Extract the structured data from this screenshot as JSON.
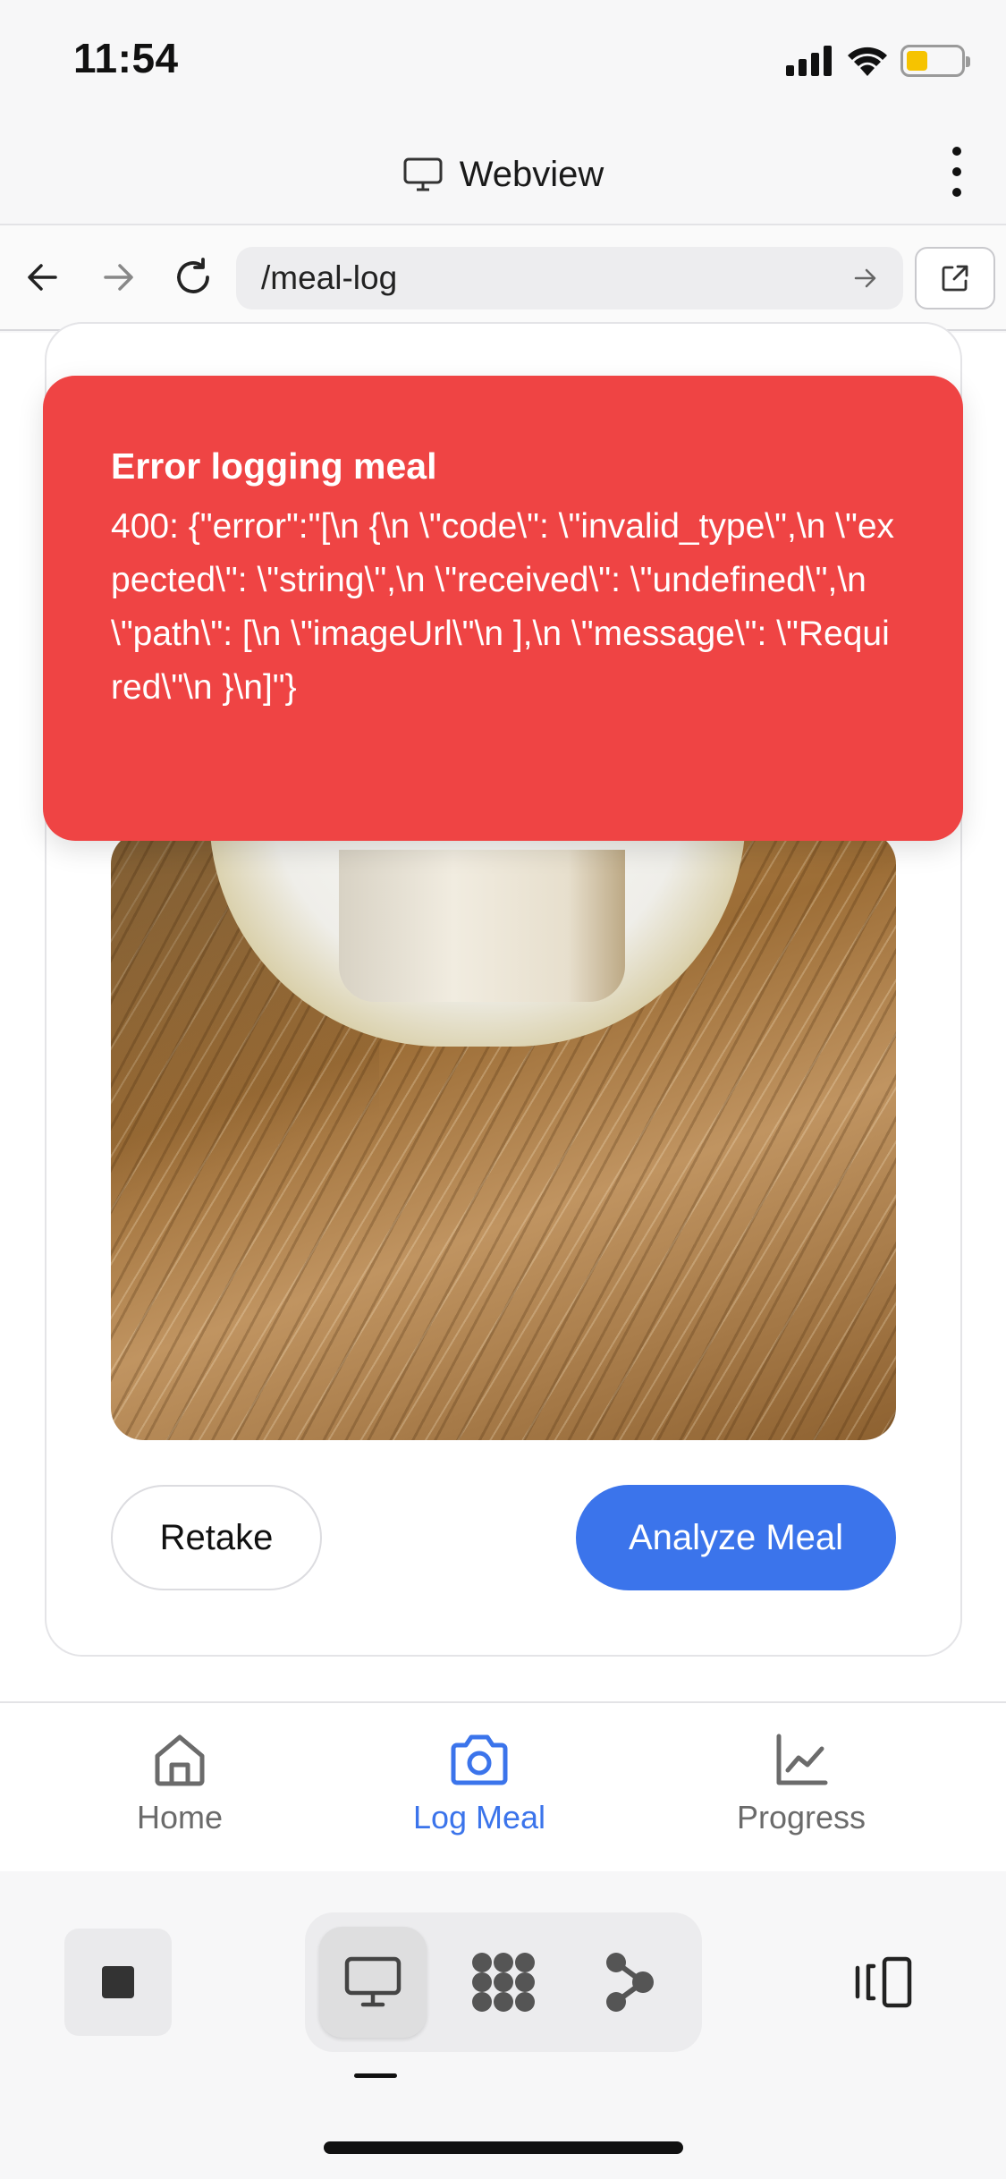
{
  "status_bar": {
    "time": "11:54"
  },
  "webview": {
    "title": "Webview"
  },
  "url_bar": {
    "url": "/meal-log"
  },
  "error_toast": {
    "title": "Error logging meal",
    "message": "400: {\"error\":\"[\\n {\\n \\\"code\\\": \\\"invalid_type\\\",\\n \\\"expected\\\": \\\"string\\\",\\n \\\"received\\\": \\\"undefined\\\",\\n \\\"path\\\": [\\n \\\"imageUrl\\\"\\n ],\\n \\\"message\\\": \\\"Required\\\"\\n }\\n]\"}"
  },
  "actions": {
    "retake_label": "Retake",
    "analyze_label": "Analyze Meal"
  },
  "tabs": [
    {
      "label": "Home",
      "icon": "home-icon",
      "active": false
    },
    {
      "label": "Log Meal",
      "icon": "camera-icon",
      "active": true
    },
    {
      "label": "Progress",
      "icon": "chart-line-icon",
      "active": false
    }
  ],
  "colors": {
    "accent": "#3b74eb",
    "error": "#ef4444",
    "battery": "#f6c300"
  }
}
